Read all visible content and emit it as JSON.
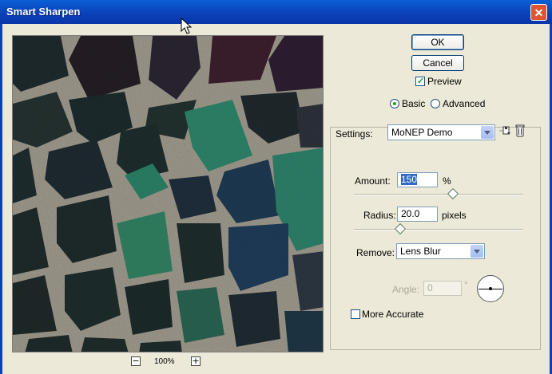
{
  "window": {
    "title": "Smart Sharpen",
    "close_symbol": "✕"
  },
  "zoom": {
    "minus": "−",
    "level": "100%",
    "plus": "+"
  },
  "buttons": {
    "ok": "OK",
    "cancel": "Cancel"
  },
  "preview": {
    "label": "Preview",
    "checked": true
  },
  "mode": {
    "basic": "Basic",
    "advanced": "Advanced",
    "selected": "Basic"
  },
  "settings": {
    "label": "Settings:",
    "value": "MoNEP Demo",
    "save_icon": "save-settings-icon",
    "delete_icon": "trash-icon"
  },
  "amount": {
    "label": "Amount:",
    "value": "150",
    "unit": "%",
    "slider_fraction": 0.58
  },
  "radius": {
    "label": "Radius:",
    "value": "20.0",
    "unit": "pixels",
    "slider_fraction": 0.27
  },
  "remove": {
    "label": "Remove:",
    "value": "Lens Blur"
  },
  "angle": {
    "label": "Angle:",
    "value": "0",
    "unit": "°"
  },
  "more_accurate": {
    "label": "More Accurate",
    "checked": false
  }
}
